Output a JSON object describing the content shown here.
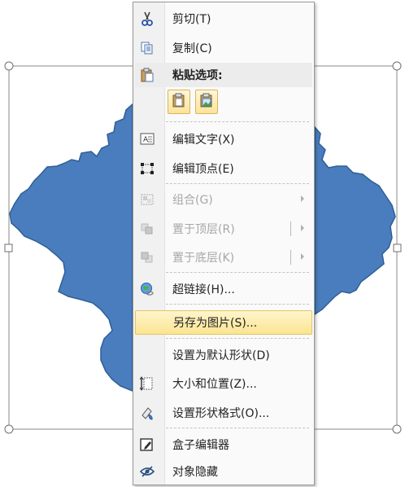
{
  "colors": {
    "shape_fill": "#4a7dbd",
    "shape_stroke": "#2f5f97",
    "handle_fill": "#ffffff",
    "handle_stroke": "#6f6f6f",
    "menu_bg": "#fafafa",
    "hover_bg": "#fbe591"
  },
  "menu": {
    "cut": "剪切(T)",
    "copy": "复制(C)",
    "paste_options": "粘贴选项:",
    "paste_icons": [
      "paste-keep-format-icon",
      "paste-picture-icon"
    ],
    "edit_text": "编辑文字(X)",
    "edit_points": "编辑顶点(E)",
    "group": "组合(G)",
    "bring_to_front": "置于顶层(R)",
    "send_to_back": "置于底层(K)",
    "hyperlink": "超链接(H)...",
    "save_as_picture": "另存为图片(S)...",
    "set_default_shape": "设置为默认形状(D)",
    "size_position": "大小和位置(Z)...",
    "format_shape": "设置形状格式(O)...",
    "box_editor": "盒子编辑器",
    "hide_object": "对象隐藏"
  }
}
